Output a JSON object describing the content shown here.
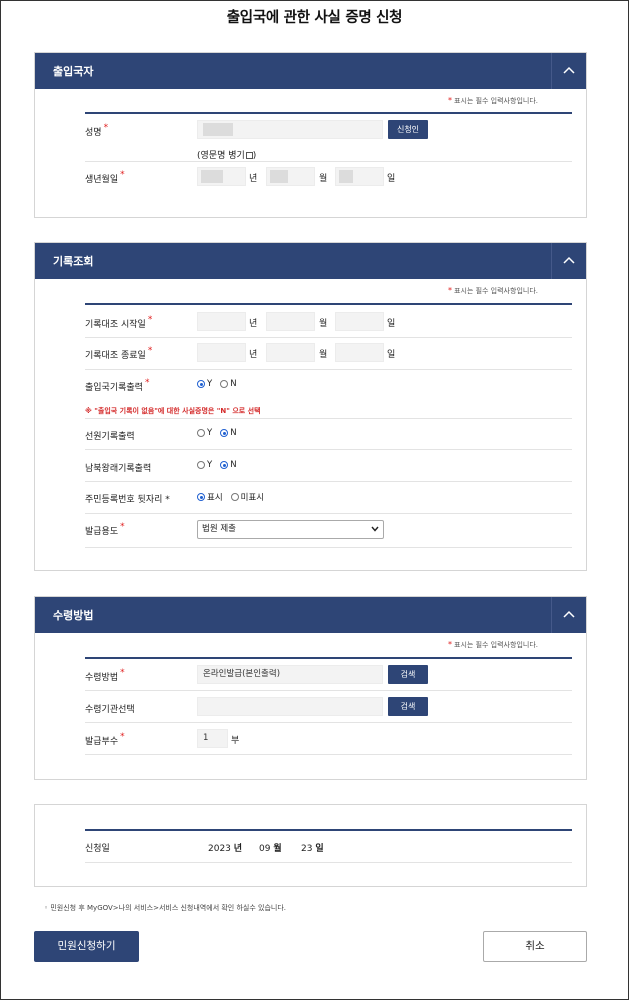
{
  "page": {
    "title": "출입국에 관한 사실 증명 신청"
  },
  "required_note": "표시는 필수 입력사항입니다.",
  "applicant": {
    "title": "출입국자",
    "name_label": "성명",
    "applicant_button": "신청인",
    "english_name_label": "(영문명 병기",
    "english_name_close": ")",
    "birth_label": "생년월일",
    "year_unit": "년",
    "month_unit": "월",
    "day_unit": "일"
  },
  "records": {
    "title": "기록조회",
    "start_label": "기록대조 시작일",
    "end_label": "기록대조 종료일",
    "year_unit": "년",
    "month_unit": "월",
    "day_unit": "일",
    "immigration_label": "출입국기록출력",
    "opt_y": "Y",
    "opt_n": "N",
    "warning": "※ \"출입국 기록이 없음\"에 대한 사실증명은 \"N\" 으로 선택",
    "crew_label": "선원기록출력",
    "north_label": "남북왕래기록출력",
    "rrn_label": "주민등록번호 뒷자리 *",
    "show": "표시",
    "hide": "미표시",
    "purpose_label": "발급용도",
    "purpose_value": "법원 제출"
  },
  "receipt": {
    "title": "수령방법",
    "method_label": "수령방법",
    "method_value": "온라인발급(본인출력)",
    "search": "검색",
    "agency_label": "수령기관선택",
    "copies_label": "발급부수",
    "copies_value": "1",
    "copies_unit": "부"
  },
  "application": {
    "date_label": "신청일",
    "year": "2023",
    "year_unit": "년",
    "month": "09",
    "month_unit": "월",
    "day": "23",
    "day_unit": "일"
  },
  "notice": "민원신청 후 MyGOV>나의 서비스>서비스 신청내역에서 확인 하실수 있습니다.",
  "buttons": {
    "submit": "민원신청하기",
    "cancel": "취소"
  },
  "colors": {
    "primary": "#2e4576",
    "required": "#e02020",
    "radio_selected": "#1f5fd0"
  }
}
